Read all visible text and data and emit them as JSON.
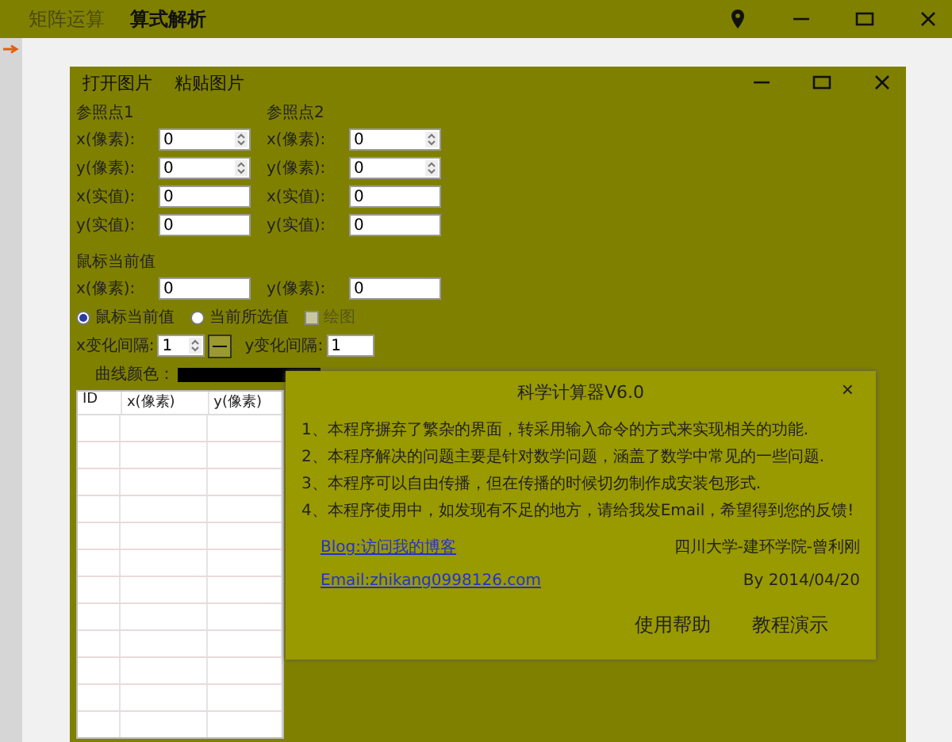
{
  "menu_tabs": [
    {
      "label": "矩阵运算",
      "selected": false
    },
    {
      "label": "算式解析",
      "selected": true
    }
  ],
  "image_window": {
    "toolbar": [
      "打开图片",
      "粘贴图片"
    ]
  },
  "ref_points": [
    {
      "title": "参照点1",
      "fields": [
        {
          "label": "x(像素):",
          "value": "0",
          "kind": "spin"
        },
        {
          "label": "y(像素):",
          "value": "0",
          "kind": "spin"
        },
        {
          "label": "x(实值):",
          "value": "0",
          "kind": "text"
        },
        {
          "label": "y(实值):",
          "value": "0",
          "kind": "text"
        }
      ]
    },
    {
      "title": "参照点2",
      "fields": [
        {
          "label": "x(像素):",
          "value": "0",
          "kind": "spin"
        },
        {
          "label": "y(像素):",
          "value": "0",
          "kind": "spin"
        },
        {
          "label": "x(实值):",
          "value": "0",
          "kind": "text"
        },
        {
          "label": "y(实值):",
          "value": "0",
          "kind": "text"
        }
      ]
    }
  ],
  "mouse": {
    "title": "鼠标当前值",
    "fields": [
      {
        "label": "x(像素):",
        "value": "0"
      },
      {
        "label": "y(像素):",
        "value": "0"
      }
    ]
  },
  "modes": [
    {
      "label": "鼠标当前值",
      "selected": true
    },
    {
      "label": "当前所选值",
      "selected": false
    }
  ],
  "plot_checkbox": {
    "label": "绘图",
    "checked": false,
    "disabled": true
  },
  "interval": {
    "x_label": "x变化间隔:",
    "x_value": "1",
    "y_label": "y变化间隔:",
    "y_value": "1"
  },
  "curve_color": {
    "label": "曲线颜色：",
    "color": "#000000"
  },
  "table": {
    "columns": [
      "ID",
      "x(像素)",
      "y(像素)"
    ]
  },
  "about_dialog": {
    "title": "科学计算器V6.0",
    "close": "×",
    "lines": [
      "1、本程序摒弃了繁杂的界面，转采用输入命令的方式来实现相关的功能.",
      "2、本程序解决的问题主要是针对数学问题，涵盖了数学中常见的一些问题.",
      "3、本程序可以自由传播，但在传播的时候切勿制作成安装包形式.",
      "4、本程序使用中，如发现有不足的地方，请给我发Email，希望得到您的反馈!"
    ],
    "links": [
      "Blog:访问我的博客",
      "Email:zhikang0998126.com"
    ],
    "author": "四川大学-建环学院-曾利刚",
    "date": "By 2014/04/20",
    "buttons": [
      "使用帮助",
      "教程演示"
    ]
  }
}
